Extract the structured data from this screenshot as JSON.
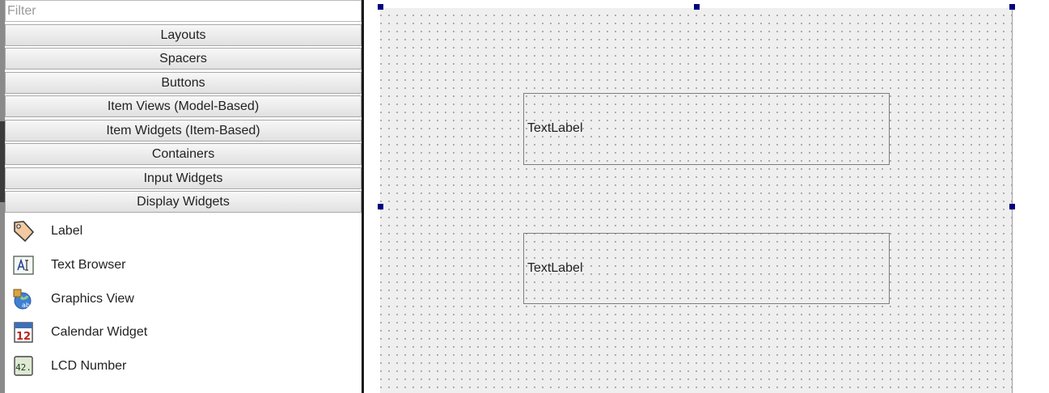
{
  "widget_box": {
    "filter_placeholder": "Filter",
    "categories": [
      "Layouts",
      "Spacers",
      "Buttons",
      "Item Views (Model-Based)",
      "Item Widgets (Item-Based)",
      "Containers",
      "Input Widgets",
      "Display Widgets"
    ],
    "display_widgets": [
      {
        "label": "Label",
        "icon": "label-tag-icon"
      },
      {
        "label": "Text Browser",
        "icon": "text-browser-icon"
      },
      {
        "label": "Graphics View",
        "icon": "graphics-view-icon"
      },
      {
        "label": "Calendar Widget",
        "icon": "calendar-icon",
        "icon_text": "12"
      },
      {
        "label": "LCD Number",
        "icon": "lcd-number-icon",
        "icon_text": "42."
      }
    ]
  },
  "form": {
    "labels": [
      "TextLabel",
      "TextLabel"
    ],
    "selection_color": "#000080"
  }
}
